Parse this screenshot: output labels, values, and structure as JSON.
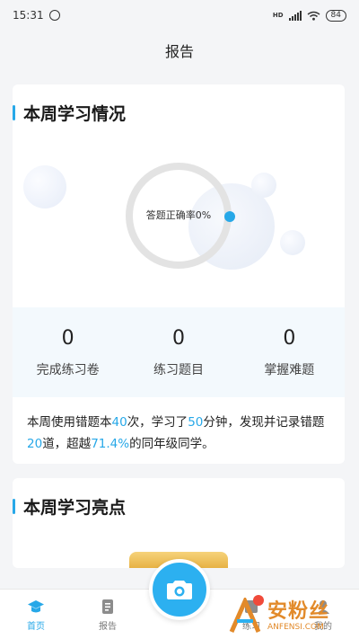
{
  "status_bar": {
    "time": "15:31",
    "network": "HD",
    "battery": "84"
  },
  "header": {
    "title": "报告"
  },
  "weekly": {
    "title": "本周学习情况",
    "ring": {
      "label": "答题正确率0%",
      "accuracy_fraction": 0
    },
    "stats": [
      {
        "value": "0",
        "label": "完成练习卷"
      },
      {
        "value": "0",
        "label": "练习题目"
      },
      {
        "value": "0",
        "label": "掌握难题"
      }
    ],
    "summary": {
      "p1": "本周使用错题本",
      "times": "40",
      "p2": "次，学习了",
      "minutes": "50",
      "p3": "分钟，发现并记录错题",
      "errors": "20",
      "p4": "道，超越",
      "percent": "71.4%",
      "p5": "的同年级同学。"
    }
  },
  "highlights": {
    "title": "本周学习亮点"
  },
  "tabbar": {
    "items": [
      {
        "label": "首页",
        "icon": "graduation-cap-icon",
        "active": true
      },
      {
        "label": "报告",
        "icon": "report-book-icon",
        "active": false
      },
      {
        "label": "",
        "icon": "camera-icon",
        "active": false
      },
      {
        "label": "练习",
        "icon": "practice-icon",
        "active": false
      },
      {
        "label": "我的",
        "icon": "profile-icon",
        "active": false
      }
    ]
  },
  "watermark": {
    "cn": "安粉丝",
    "en": "ANFENSI.COM"
  },
  "colors": {
    "accent": "#27a8e8",
    "badge": "#f04a3a",
    "watermark": "#e28a2a"
  }
}
